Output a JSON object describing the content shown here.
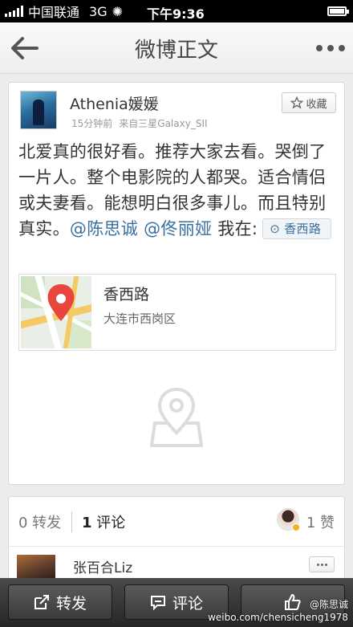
{
  "status_bar": {
    "carrier": "中国联通",
    "network": "3G",
    "time": "下午9:36"
  },
  "nav": {
    "title": "微博正文"
  },
  "post": {
    "username": "Athenia媛媛",
    "time_ago": "15分钟前",
    "source": "来自三星Galaxy_SII",
    "favorite_label": "收藏",
    "text": "北爱真的很好看。推荐大家去看。哭倒了一片人。整个电影院的人都哭。适合情侣或夫妻看。能想明白很多事儿。而且特别真实。",
    "mention_1": "@陈思诚",
    "mention_2": "@佟丽娅",
    "location_prefix": "我在:",
    "location_chip": "香西路",
    "location_card": {
      "name": "香西路",
      "address": "大连市西岗区"
    }
  },
  "actions": {
    "repost": "0 转发",
    "comment_count": "1",
    "comment_word": "评论",
    "like": "1 赞"
  },
  "comment": {
    "name": "张百合Liz"
  },
  "toolbar": {
    "repost": "转发",
    "comment": "评论"
  },
  "watermark": {
    "handle": "@陈思诚",
    "url": "weibo.com/chensicheng1978"
  },
  "colors": {
    "link": "#3a6f9e",
    "toolbar": "#333333",
    "pin": "#e8453c"
  }
}
